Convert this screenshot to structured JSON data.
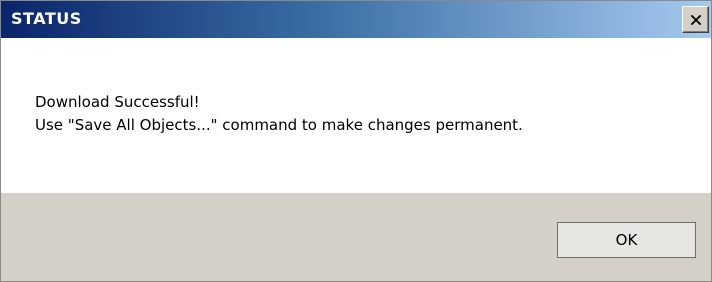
{
  "dialog": {
    "title": "STATUS",
    "close_icon": "close-x-icon",
    "message_lines": [
      "Download Successful!",
      "Use \"Save All Objects...\" command to make changes permanent."
    ],
    "ok_label": "OK"
  },
  "colors": {
    "titlebar_start": "#0a246a",
    "titlebar_end": "#a6caf0",
    "footer_bg": "#d4d0c8",
    "content_bg": "#ffffff"
  }
}
